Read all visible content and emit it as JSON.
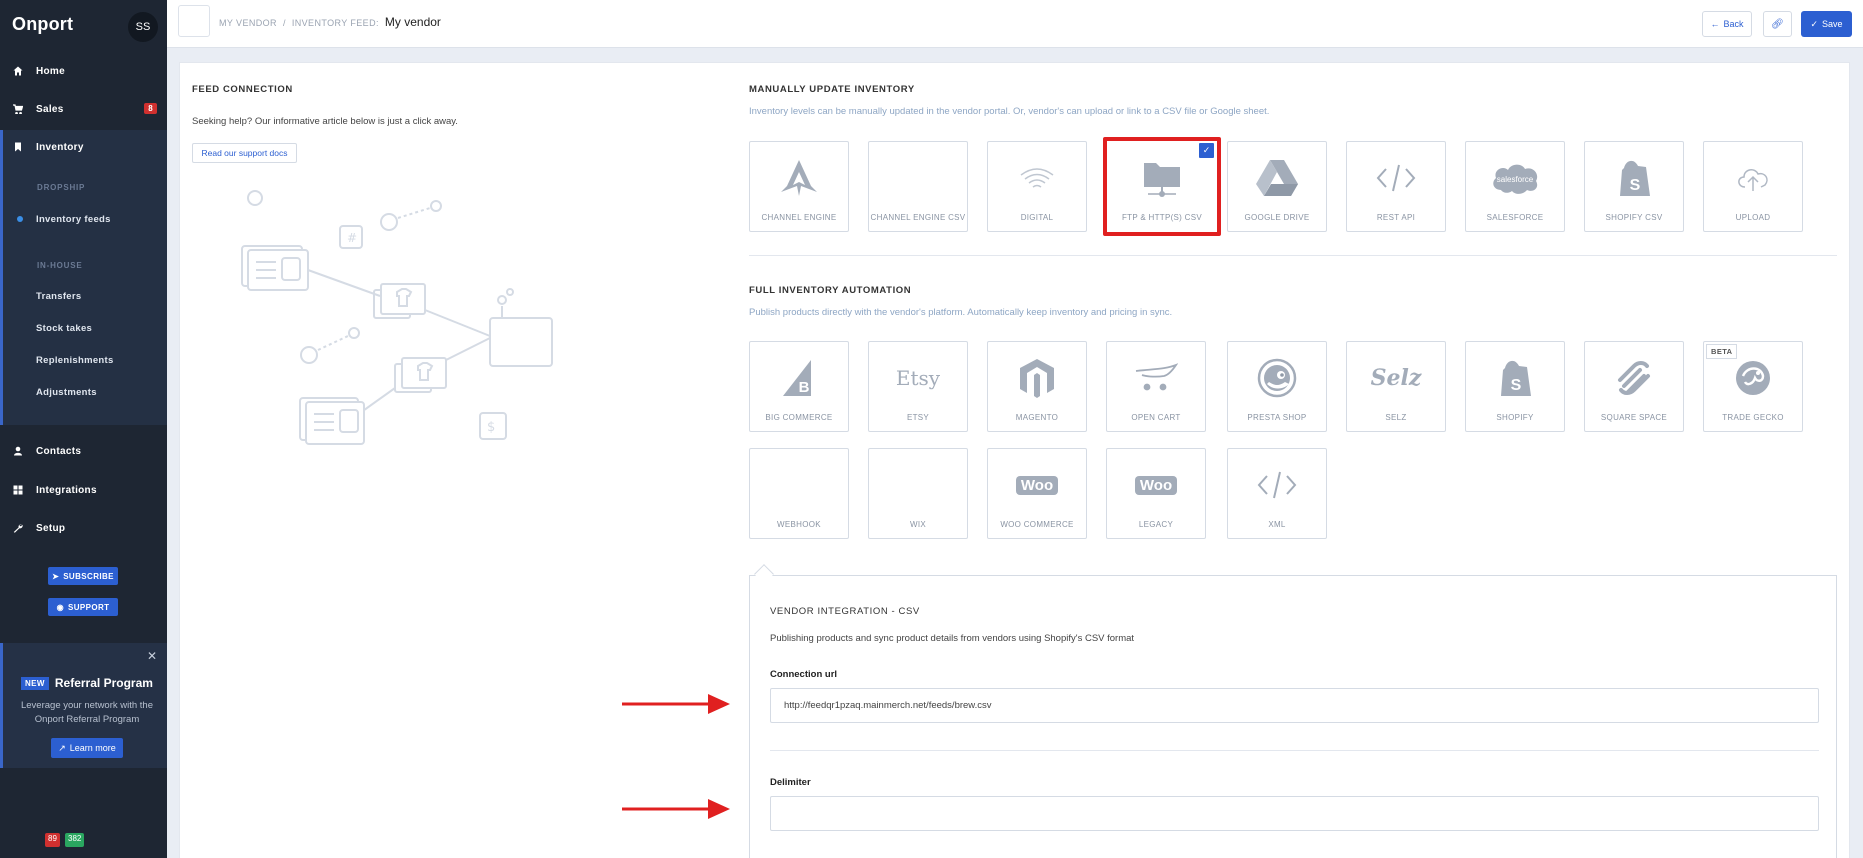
{
  "sidebar": {
    "brand": "Onport",
    "avatar": "SS",
    "nav": {
      "home": "Home",
      "sales": "Sales",
      "sales_badge": "8",
      "inventory": "Inventory",
      "contacts": "Contacts",
      "integrations": "Integrations",
      "setup": "Setup"
    },
    "inventory_group": {
      "dropship_label": "DROPSHIP",
      "inventory_feeds": "Inventory feeds",
      "inhouse_label": "IN-HOUSE",
      "transfers": "Transfers",
      "stock_takes": "Stock takes",
      "replenishments": "Replenishments",
      "adjustments": "Adjustments"
    },
    "subscribe_label": "SUBSCRIBE",
    "support_label": "SUPPORT",
    "referral": {
      "new_badge": "NEW",
      "title": "Referral Program",
      "text": "Leverage your network with the Onport Referral Program",
      "button": "Learn more"
    },
    "counters": {
      "red": "89",
      "green": "382"
    }
  },
  "topbar": {
    "crumb_vendor": "MY VENDOR",
    "crumb_sep": "/",
    "crumb_feed": "INVENTORY FEED:",
    "current": "My vendor",
    "back_label": "Back",
    "save_label": "Save"
  },
  "feed_connection": {
    "title": "FEED CONNECTION",
    "help_text": "Seeking help? Our informative article below is just a click away.",
    "docs_button": "Read our support docs"
  },
  "manual": {
    "title": "MANUALLY UPDATE INVENTORY",
    "description": "Inventory levels can be manually updated in the vendor portal. Or, vendor's can upload or link to a CSV file or Google sheet.",
    "tiles": [
      {
        "label": "CHANNEL ENGINE",
        "icon": "channel-engine-icon"
      },
      {
        "label": "CHANNEL ENGINE CSV",
        "icon": ""
      },
      {
        "label": "DIGITAL",
        "icon": "wifi-icon"
      },
      {
        "label": "FTP & HTTP(S) CSV",
        "icon": "ftp-folder-icon",
        "selected": true
      },
      {
        "label": "GOOGLE DRIVE",
        "icon": "google-drive-icon"
      },
      {
        "label": "REST API",
        "icon": "code-icon"
      },
      {
        "label": "SALESFORCE",
        "icon": "salesforce-icon"
      },
      {
        "label": "SHOPIFY CSV",
        "icon": "shopify-icon"
      },
      {
        "label": "UPLOAD",
        "icon": "cloud-upload-icon"
      }
    ]
  },
  "automation": {
    "title": "FULL INVENTORY AUTOMATION",
    "description": "Publish products directly with the vendor's platform. Automatically keep inventory and pricing in sync.",
    "tiles": [
      {
        "label": "BIG COMMERCE",
        "icon": "bigcommerce-icon"
      },
      {
        "label": "ETSY",
        "icon": "etsy-icon",
        "logo_text": "Etsy"
      },
      {
        "label": "MAGENTO",
        "icon": "magento-icon"
      },
      {
        "label": "OPEN CART",
        "icon": "opencart-icon"
      },
      {
        "label": "PRESTA SHOP",
        "icon": "prestashop-icon"
      },
      {
        "label": "SELZ",
        "icon": "selz-icon",
        "logo_text": "Selz"
      },
      {
        "label": "SHOPIFY",
        "icon": "shopify-icon"
      },
      {
        "label": "SQUARE SPACE",
        "icon": "squarespace-icon"
      },
      {
        "label": "TRADE GECKO",
        "icon": "tradegecko-icon",
        "badge": "BETA"
      },
      {
        "label": "WEBHOOK",
        "icon": ""
      },
      {
        "label": "WIX",
        "icon": ""
      },
      {
        "label": "WOO COMMERCE",
        "icon": "woo-icon",
        "logo_text": "Woo"
      },
      {
        "label": "LEGACY",
        "icon": "woo-icon",
        "logo_text": "Woo"
      },
      {
        "label": "XML",
        "icon": "code-icon"
      }
    ]
  },
  "integration": {
    "title": "VENDOR INTEGRATION - CSV",
    "description": "Publishing products and sync product details from vendors using Shopify's CSV format",
    "connection_url_label": "Connection url",
    "connection_url_value": "http://feedqr1pzaq.mainmerch.net/feeds/brew.csv",
    "delimiter_label": "Delimiter",
    "delimiter_value": ""
  },
  "colors": {
    "accent": "#2c5fd1",
    "highlight": "#e02020",
    "sidebar": "#1e2633"
  }
}
